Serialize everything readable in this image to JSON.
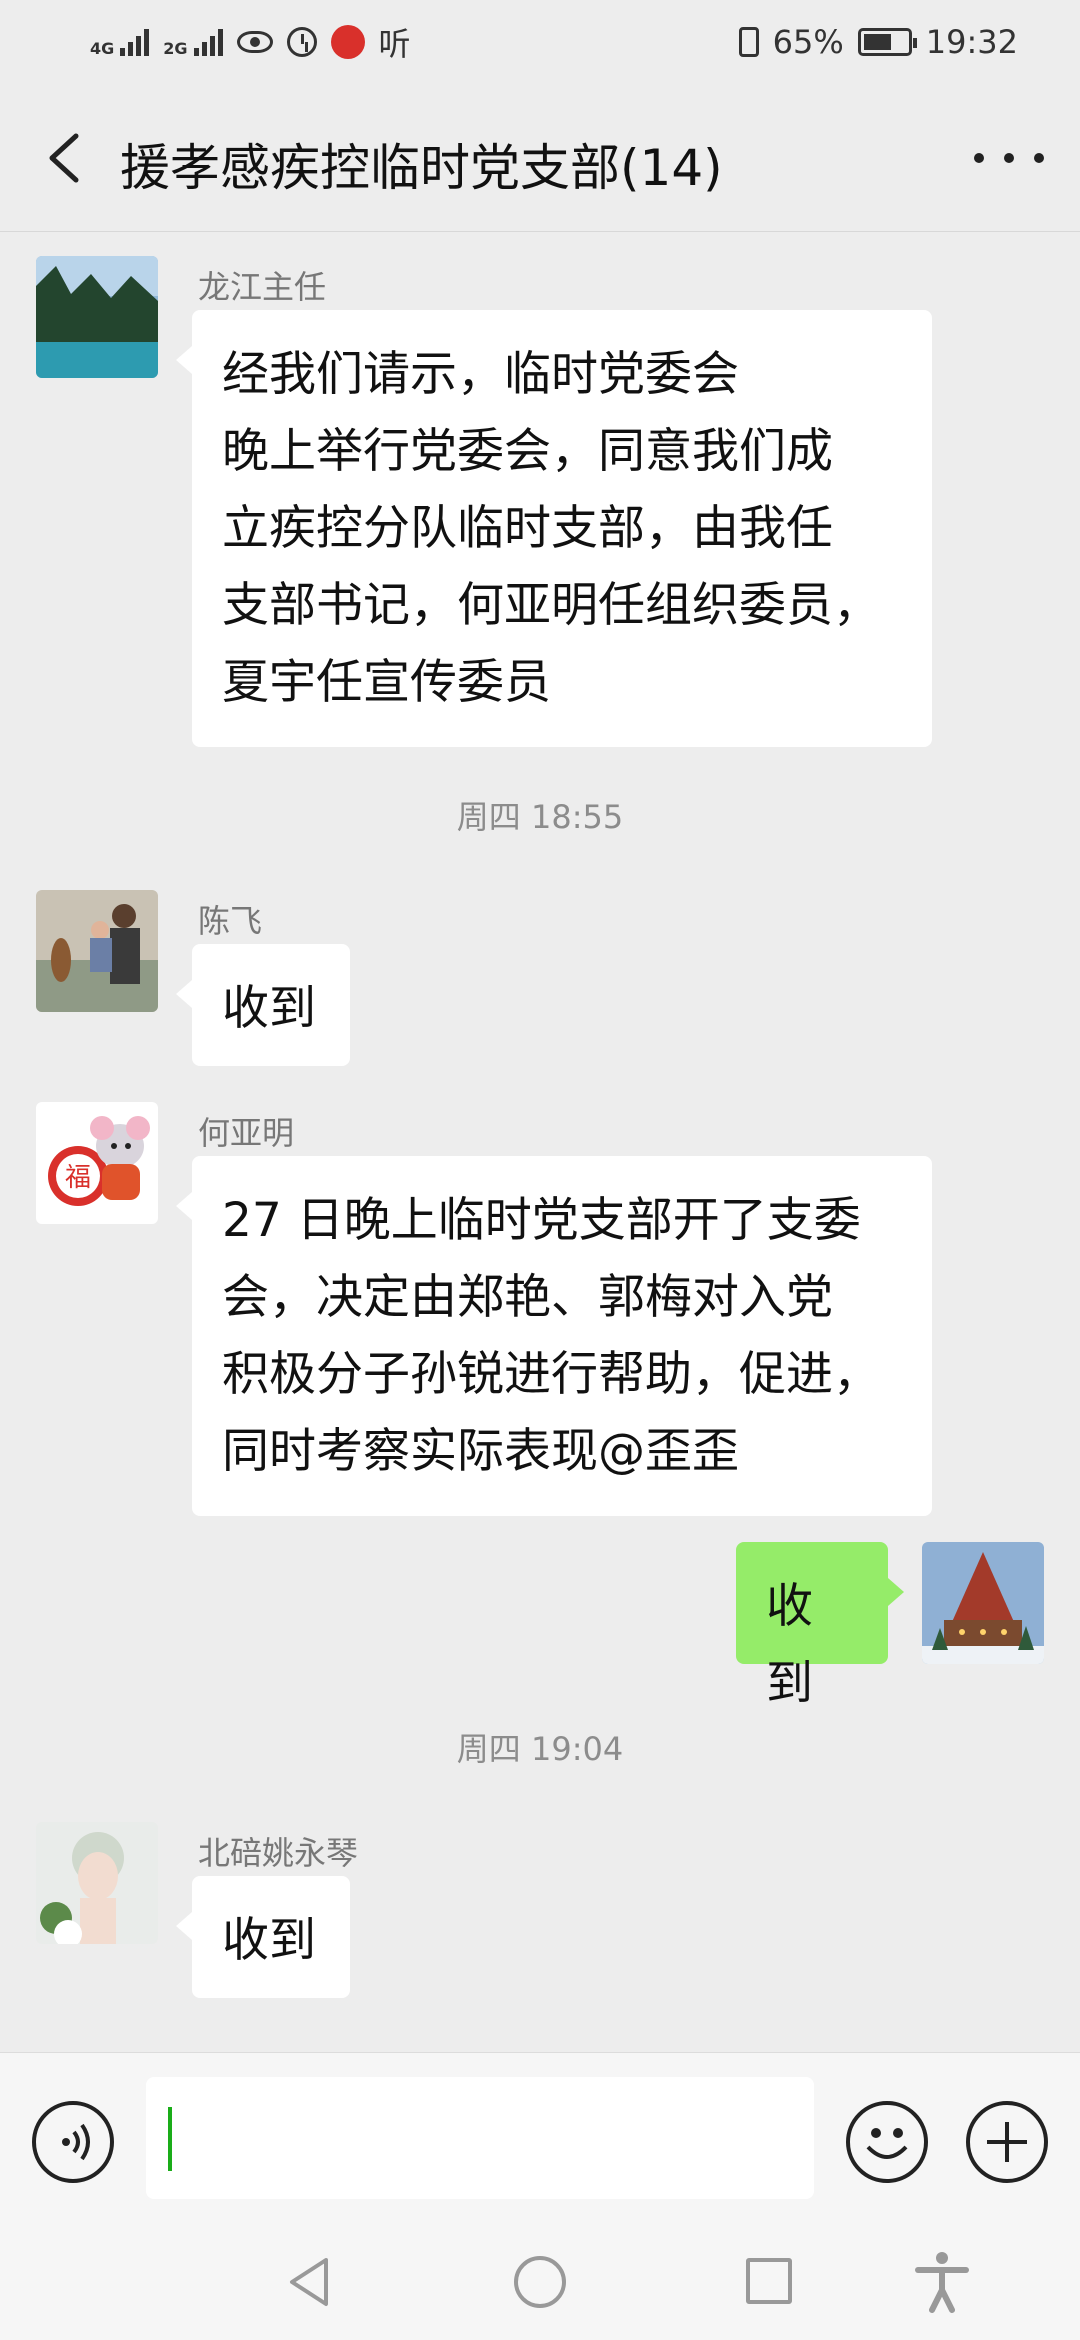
{
  "status_bar": {
    "network_1": "4G",
    "network_2": "2G",
    "app_notification": "听",
    "battery": "65%",
    "time": "19:32",
    "battery_level": 0.65
  },
  "header": {
    "title": "援孝感疾控临时党支部(14)"
  },
  "messages": [
    {
      "sender": "龙江主任",
      "lines": [
        "经我们请示，临时党委会",
        "晚上举行党委会，同意我们成",
        "立疾控分队临时支部，由我任",
        "支部书记，何亚明任组织委员，",
        "夏宇任宣传委员"
      ]
    },
    {
      "timestamp": "周四 18:55"
    },
    {
      "sender": "陈飞",
      "text": "收到"
    },
    {
      "sender": "何亚明",
      "lines": [
        "27 日晚上临时党支部开了支委",
        "会，决定由郑艳、郭梅对入党",
        "积极分子孙锐进行帮助，促进，",
        "同时考察实际表现@歪歪"
      ]
    },
    {
      "self": true,
      "text": "收到"
    },
    {
      "timestamp": "周四 19:04"
    },
    {
      "sender": "北碚姚永琴",
      "text": "收到"
    }
  ],
  "colors": {
    "background": "#ededed",
    "self_bubble": "#95ec69",
    "other_bubble": "#ffffff",
    "cursor": "#1aad19"
  },
  "icons": {
    "back": "back-arrow-icon",
    "more": "more-dots-icon",
    "voice": "voice-icon",
    "emoji": "emoji-icon",
    "plus": "plus-icon"
  }
}
